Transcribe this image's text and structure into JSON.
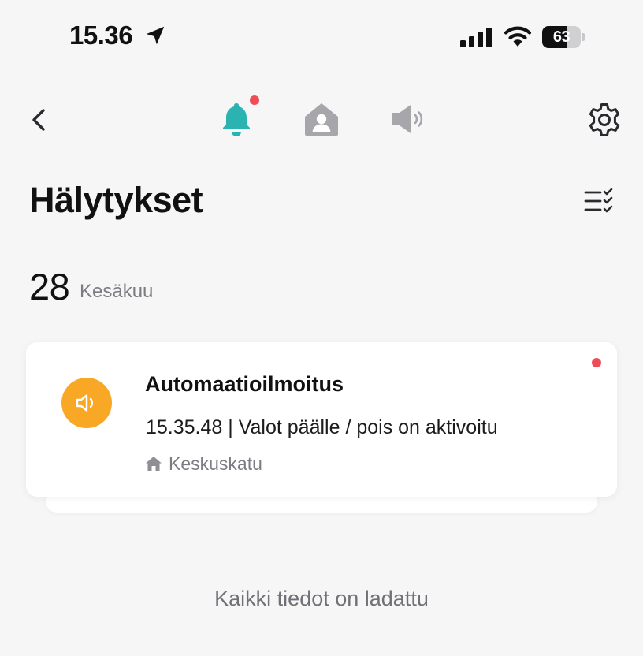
{
  "status_bar": {
    "time": "15.36",
    "battery_percent": "63",
    "battery_level": 0.63
  },
  "nav": {
    "tabs": [
      {
        "icon": "bell-icon",
        "active": true,
        "has_unread": true
      },
      {
        "icon": "home-person-icon",
        "active": false
      },
      {
        "icon": "speaker-icon",
        "active": false
      }
    ],
    "accent_color": "#2bb3b1",
    "inactive_color": "#a6a6ab"
  },
  "page": {
    "title": "Hälytykset"
  },
  "date_group": {
    "day": "28",
    "month": "Kesäkuu"
  },
  "notifications": [
    {
      "title": "Automaatioilmoitus",
      "body": "15.35.48 | Valot päälle / pois on aktivoitu",
      "location": "Keskuskatu",
      "icon": "speaker-icon",
      "icon_color": "#f9a825",
      "unread": true
    }
  ],
  "footer": {
    "text": "Kaikki tiedot on ladattu"
  }
}
